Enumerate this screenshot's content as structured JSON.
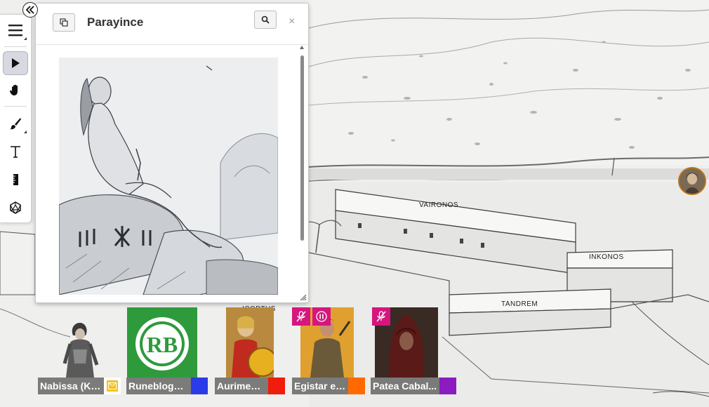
{
  "map": {
    "labels": {
      "vaironos": "VAIRONOS",
      "inkonos": "INKONOS",
      "tandrem": "TANDREM",
      "partial": "ICOPTUS"
    }
  },
  "toolbar": {
    "collapse_icon": "double-chevron-left-icon",
    "tools": [
      {
        "name": "menu",
        "icon": "hamburger-icon"
      },
      {
        "name": "select",
        "icon": "cursor-icon",
        "active": true
      },
      {
        "name": "pan",
        "icon": "hand-icon"
      },
      {
        "name": "draw",
        "icon": "brush-icon"
      },
      {
        "name": "text",
        "icon": "text-icon"
      },
      {
        "name": "measure",
        "icon": "ruler-icon"
      },
      {
        "name": "dice",
        "icon": "d20-icon"
      }
    ]
  },
  "handout": {
    "title": "Parayince",
    "popout_icon": "popout-icon",
    "search_icon": "search-icon",
    "close_label": "×"
  },
  "players": [
    {
      "name": "Nabissa (Ka...",
      "color": "#f4c21a",
      "badge": "envelope-icon"
    },
    {
      "name": "Runeblogger",
      "color": "#2a3be8"
    },
    {
      "name": "Aurimenas",
      "color": "#f01c0c"
    },
    {
      "name": "Egistar el ...",
      "color": "#ff6a00",
      "muted": true,
      "paused": true
    },
    {
      "name": "Patea Cabal...",
      "color": "#8a1cc0",
      "muted": true
    }
  ],
  "avatar_text": {
    "runeblogger_logo": "RB"
  },
  "colors": {
    "accent_mute": "#d6157e",
    "token_ring": "#c0741f"
  }
}
